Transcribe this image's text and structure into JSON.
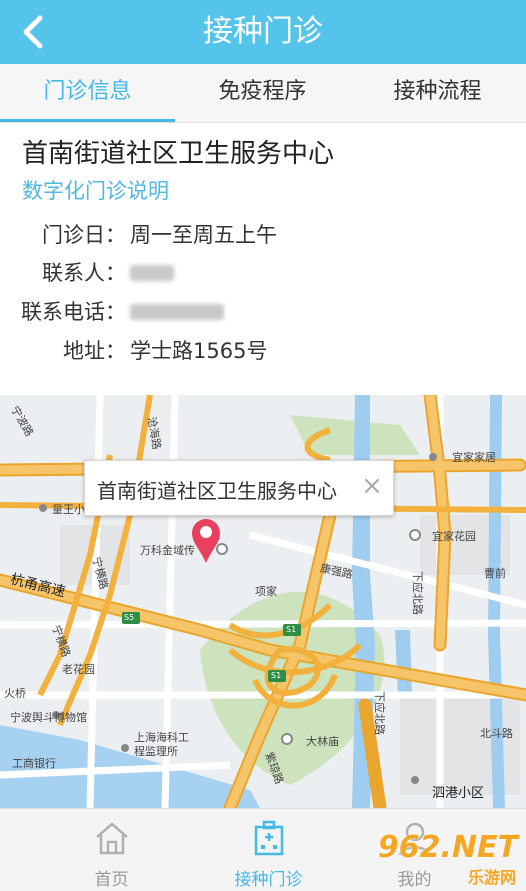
{
  "header": {
    "title": "接种门诊",
    "back_icon": "chevron-left-icon"
  },
  "tabs": [
    {
      "label": "门诊信息",
      "active": true
    },
    {
      "label": "免疫程序",
      "active": false
    },
    {
      "label": "接种流程",
      "active": false
    }
  ],
  "clinic": {
    "name": "首南街道社区卫生服务中心",
    "link": "数字化门诊说明",
    "rows": [
      {
        "label": "门诊日：",
        "value": "周一至周五上午"
      },
      {
        "label": "联系人：",
        "value": ""
      },
      {
        "label": "联系电话：",
        "value": ""
      },
      {
        "label": "地址：",
        "value": "学士路1565号"
      }
    ]
  },
  "map": {
    "popup_title": "首南街道社区卫生服务中心",
    "labels": {
      "l1": "宁波路",
      "l2": "沧海路",
      "l3": "宜家家居",
      "l4": "童王小",
      "l5": "万科金域传",
      "l6": "宜家花园",
      "l7": "宁横路",
      "l8": "康强路",
      "l9": "杭甬高速",
      "l10": "项家",
      "l11": "下应北路",
      "l12": "曹前",
      "l13": "老花园",
      "l14": "宁横路",
      "l15": "火桥",
      "l16": "宁波舆斗博物馆",
      "l17": "上海海科工",
      "l18": "程监理所",
      "l19": "大林庙",
      "l20": "北斗路",
      "l21": "工商银行",
      "l22": "紫琼路",
      "l23": "泗港小区",
      "l24": "S5",
      "l25": "S1",
      "l26": "S1",
      "l27": "下应北路"
    }
  },
  "bottom_nav": [
    {
      "label": "首页",
      "icon": "home-icon",
      "active": false
    },
    {
      "label": "接种门诊",
      "icon": "clinic-icon",
      "active": true
    },
    {
      "label": "我的",
      "icon": "user-icon",
      "active": false
    }
  ],
  "watermark": {
    "main": "962.NET",
    "sub": "乐游网"
  },
  "colors": {
    "header": "#55c4ea",
    "accent": "#45b9e6",
    "road": "#f2b13d",
    "water": "#9ecdf0"
  }
}
